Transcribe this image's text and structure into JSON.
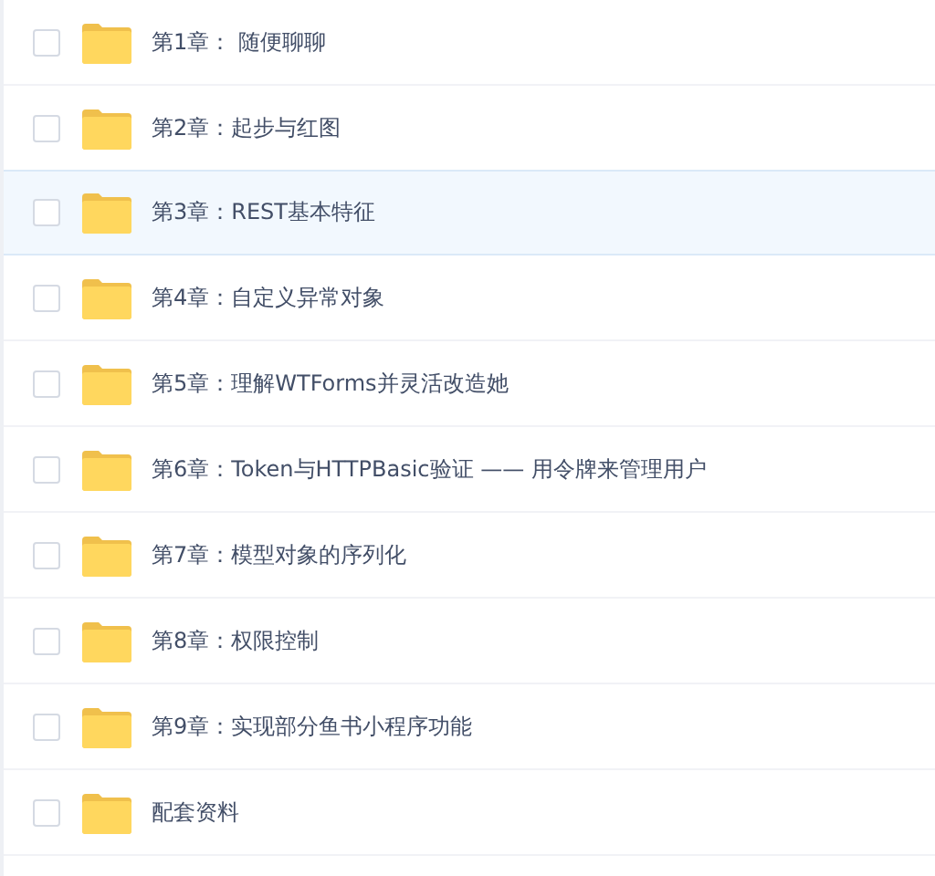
{
  "files": [
    {
      "name": "第1章： 随便聊聊",
      "checked": false,
      "highlighted": false
    },
    {
      "name": "第2章：起步与红图",
      "checked": false,
      "highlighted": false
    },
    {
      "name": "第3章：REST基本特征",
      "checked": false,
      "highlighted": true
    },
    {
      "name": "第4章：自定义异常对象",
      "checked": false,
      "highlighted": false
    },
    {
      "name": "第5章：理解WTForms并灵活改造她",
      "checked": false,
      "highlighted": false
    },
    {
      "name": "第6章：Token与HTTPBasic验证 —— 用令牌来管理用户",
      "checked": false,
      "highlighted": false
    },
    {
      "name": "第7章：模型对象的序列化",
      "checked": false,
      "highlighted": false
    },
    {
      "name": "第8章：权限控制",
      "checked": false,
      "highlighted": false
    },
    {
      "name": "第9章：实现部分鱼书小程序功能",
      "checked": false,
      "highlighted": false
    },
    {
      "name": "配套资料",
      "checked": false,
      "highlighted": false
    }
  ]
}
